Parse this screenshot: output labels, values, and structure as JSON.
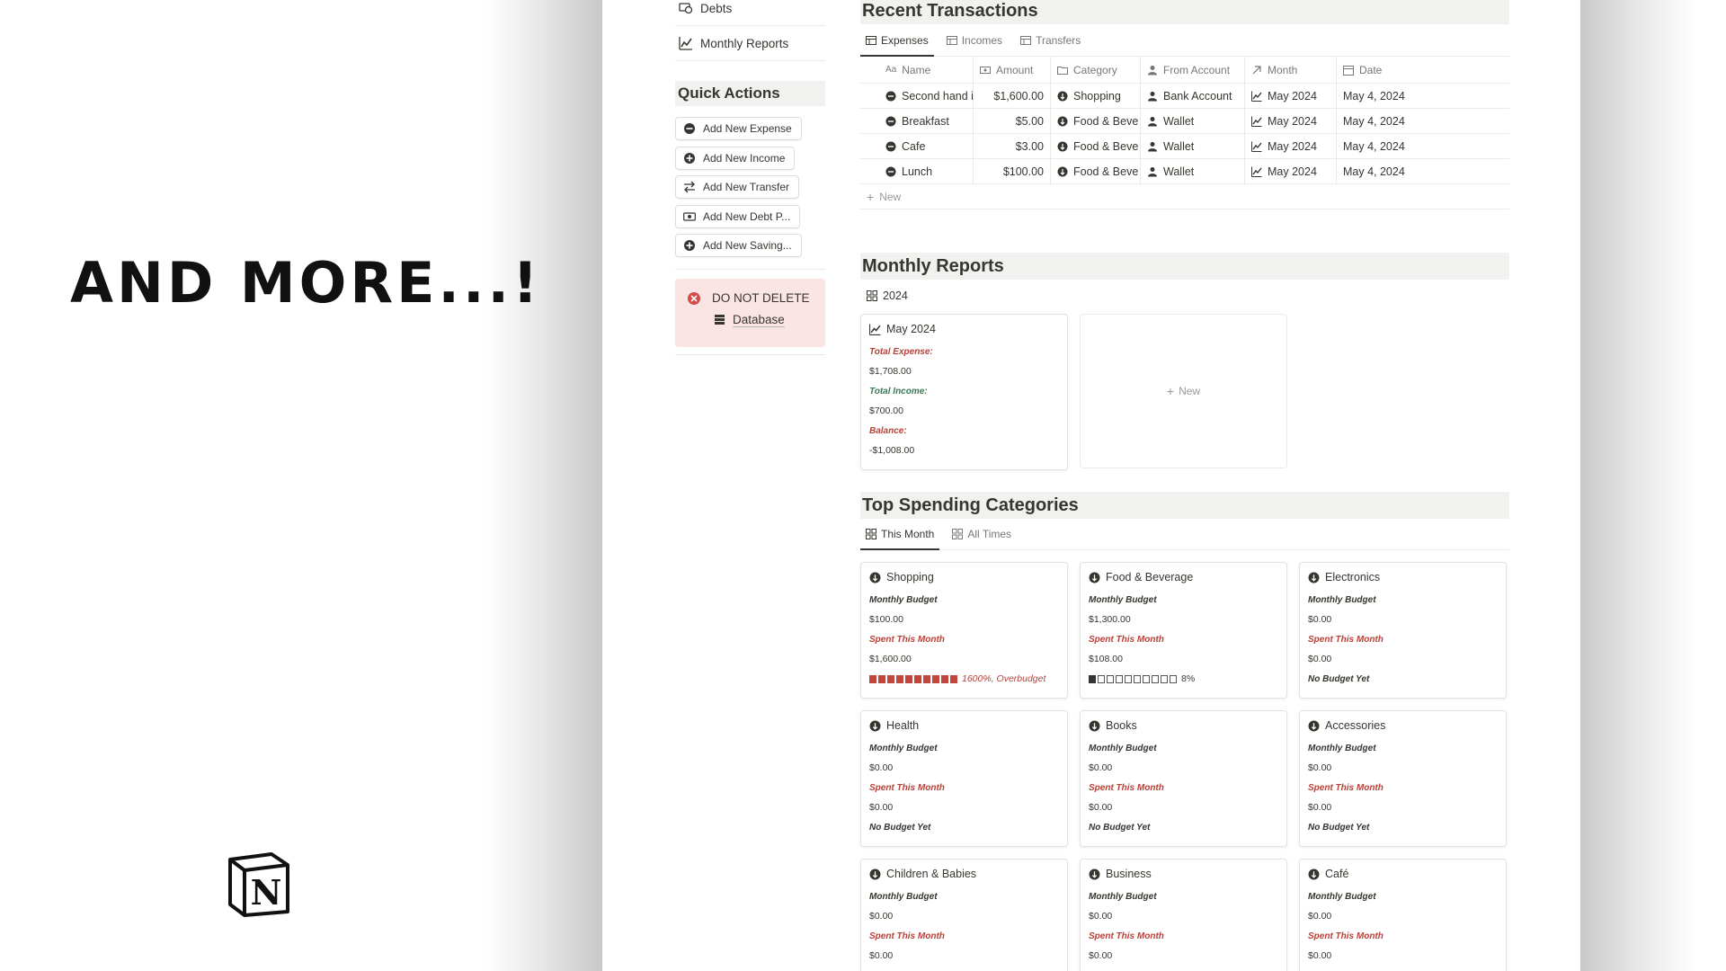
{
  "promo": {
    "headline": "AND MORE...!"
  },
  "sidebar": {
    "links": [
      {
        "label": "Debts",
        "icon": "debt-icon"
      },
      {
        "label": "Monthly Reports",
        "icon": "report-chart-icon"
      }
    ],
    "quick_actions_title": "Quick Actions",
    "quick_actions": [
      {
        "label": "Add New Expense",
        "icon": "minus-circle-icon"
      },
      {
        "label": "Add New Income",
        "icon": "plus-circle-icon"
      },
      {
        "label": "Add New Transfer",
        "icon": "transfer-icon"
      },
      {
        "label": "Add New Debt P...",
        "icon": "money-icon"
      },
      {
        "label": "Add New Saving...",
        "icon": "plus-circle-icon"
      }
    ],
    "warning": {
      "title": "DO NOT DELETE",
      "link": "Database"
    }
  },
  "transactions": {
    "title": "Recent Transactions",
    "tabs": [
      "Expenses",
      "Incomes",
      "Transfers"
    ],
    "active_tab": 0,
    "columns": [
      "Name",
      "Amount",
      "Category",
      "From Account",
      "Month",
      "Date"
    ],
    "rows": [
      {
        "name": "Second hand i",
        "amount": "$1,600.00",
        "category": "Shopping",
        "from": "Bank Account",
        "month": "May 2024",
        "date": "May 4, 2024"
      },
      {
        "name": "Breakfast",
        "amount": "$5.00",
        "category": "Food & Beve",
        "from": "Wallet",
        "month": "May 2024",
        "date": "May 4, 2024"
      },
      {
        "name": "Cafe",
        "amount": "$3.00",
        "category": "Food & Beve",
        "from": "Wallet",
        "month": "May 2024",
        "date": "May 4, 2024"
      },
      {
        "name": "Lunch",
        "amount": "$100.00",
        "category": "Food & Beve",
        "from": "Wallet",
        "month": "May 2024",
        "date": "May 4, 2024"
      }
    ],
    "new_label": "New"
  },
  "reports": {
    "title": "Monthly Reports",
    "view": "2024",
    "card": {
      "title": "May 2024",
      "expense_label": "Total Expense:",
      "expense": "$1,708.00",
      "income_label": "Total Income:",
      "income": "$700.00",
      "balance_label": "Balance:",
      "balance": "-$1,008.00"
    },
    "new_label": "New"
  },
  "categories": {
    "title": "Top Spending Categories",
    "tabs": [
      "This Month",
      "All Times"
    ],
    "active_tab": 0,
    "budget_label": "Monthly Budget",
    "spent_label": "Spent This Month",
    "items": [
      {
        "name": "Shopping",
        "budget": "$100.00",
        "spent": "$1,600.00",
        "progress": 1.0,
        "status": "1600%, Overbudget",
        "over": true
      },
      {
        "name": "Food & Beverage",
        "budget": "$1,300.00",
        "spent": "$108.00",
        "progress": 0.08,
        "status": "8%",
        "over": false
      },
      {
        "name": "Electronics",
        "budget": "$0.00",
        "spent": "$0.00",
        "status": "No Budget Yet"
      },
      {
        "name": "Health",
        "budget": "$0.00",
        "spent": "$0.00",
        "status": "No Budget Yet"
      },
      {
        "name": "Books",
        "budget": "$0.00",
        "spent": "$0.00",
        "status": "No Budget Yet"
      },
      {
        "name": "Accessories",
        "budget": "$0.00",
        "spent": "$0.00",
        "status": "No Budget Yet"
      },
      {
        "name": "Children & Babies",
        "budget": "$0.00",
        "spent": "$0.00"
      },
      {
        "name": "Business",
        "budget": "$0.00",
        "spent": "$0.00"
      },
      {
        "name": "Café",
        "budget": "$0.00",
        "spent": "$0.00"
      }
    ]
  },
  "colors": {
    "accent_red": "#b5423a",
    "accent_green": "#3b7a57",
    "warning_bg": "#fbe4e4",
    "section_bg": "#f1f1ef"
  }
}
